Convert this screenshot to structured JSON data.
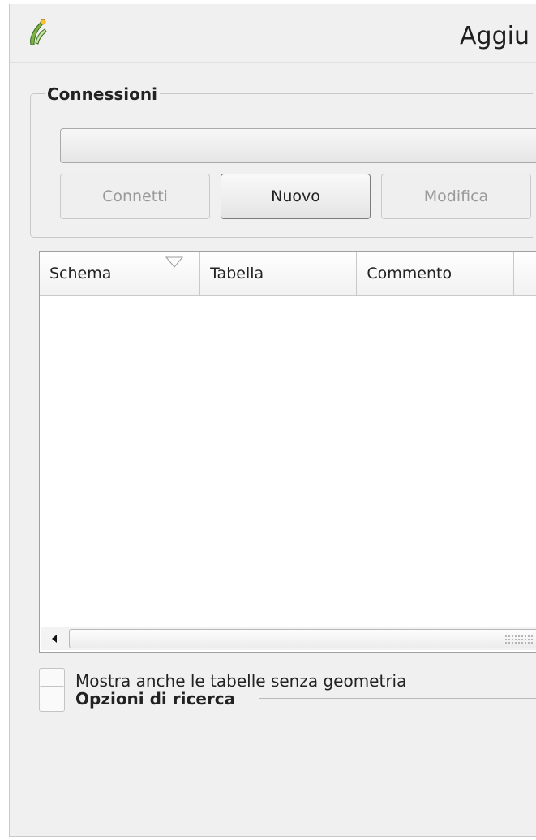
{
  "window": {
    "title": "Aggiu",
    "icon": "qgis-logo-icon"
  },
  "connections": {
    "group_title": "Connessioni",
    "selected_connection": "",
    "buttons": {
      "connect": "Connetti",
      "new": "Nuovo",
      "edit": "Modifica"
    }
  },
  "table": {
    "columns": [
      "Schema",
      "Tabella",
      "Commento"
    ],
    "sort_icon": "sort-indicator-icon",
    "rows": []
  },
  "options": {
    "show_no_geometry_label": "Mostra anche le tabelle senza geometria",
    "show_no_geometry_checked": false,
    "search_options_label": "Opzioni di ricerca",
    "search_options_checked": false
  },
  "colors": {
    "window_bg": "#f0f0f0",
    "border": "#c8c8c8",
    "disabled_text": "#9a9a9a"
  }
}
